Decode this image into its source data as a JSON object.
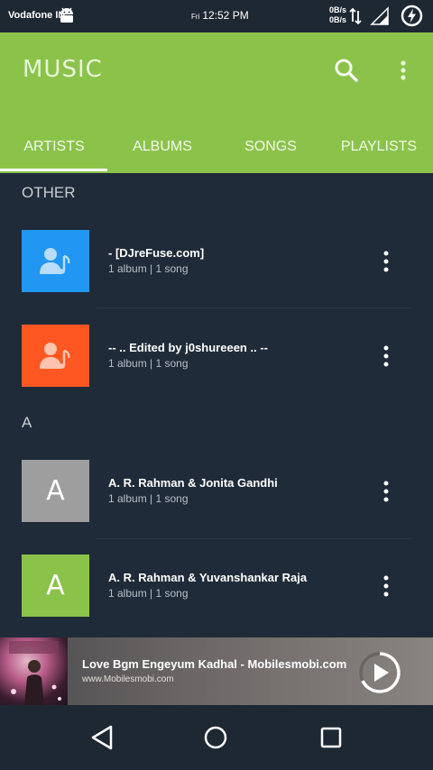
{
  "status_bar": {
    "carrier": "Vodafone IN",
    "day": "Fri",
    "time": "12:52 PM",
    "speed_up": "0B/s",
    "speed_down": "0B/s"
  },
  "app_bar": {
    "title": "MUSIC",
    "color": "#8bc34a",
    "tabs": [
      {
        "label": "ARTISTS",
        "active": true
      },
      {
        "label": "ALBUMS",
        "active": false
      },
      {
        "label": "SONGS",
        "active": false
      },
      {
        "label": "PLAYLISTS",
        "active": false
      }
    ]
  },
  "sections": [
    {
      "header": "OTHER",
      "items": [
        {
          "title": "- [DJreFuse.com]",
          "subtitle": "1 album | 1 song",
          "thumb_type": "artist-icon",
          "thumb_color": "#2196f3"
        },
        {
          "title": "-- .. Edited by j0shureeen .. --",
          "subtitle": "1 album | 1 song",
          "thumb_type": "artist-icon",
          "thumb_color": "#ff5722"
        }
      ]
    },
    {
      "header": "A",
      "items": [
        {
          "title": "A. R. Rahman & Jonita Gandhi",
          "subtitle": "1 album | 1 song",
          "thumb_type": "letter",
          "thumb_letter": "A",
          "thumb_color": "#9e9e9e"
        },
        {
          "title": "A. R. Rahman & Yuvanshankar Raja",
          "subtitle": "1 album | 1 song",
          "thumb_type": "letter",
          "thumb_letter": "A",
          "thumb_color": "#8bc34a"
        }
      ]
    }
  ],
  "now_playing": {
    "title": "Love Bgm Engeyum Kadhal - Mobilesmobi.com",
    "subtitle": "www.Mobilesmobi.com"
  }
}
